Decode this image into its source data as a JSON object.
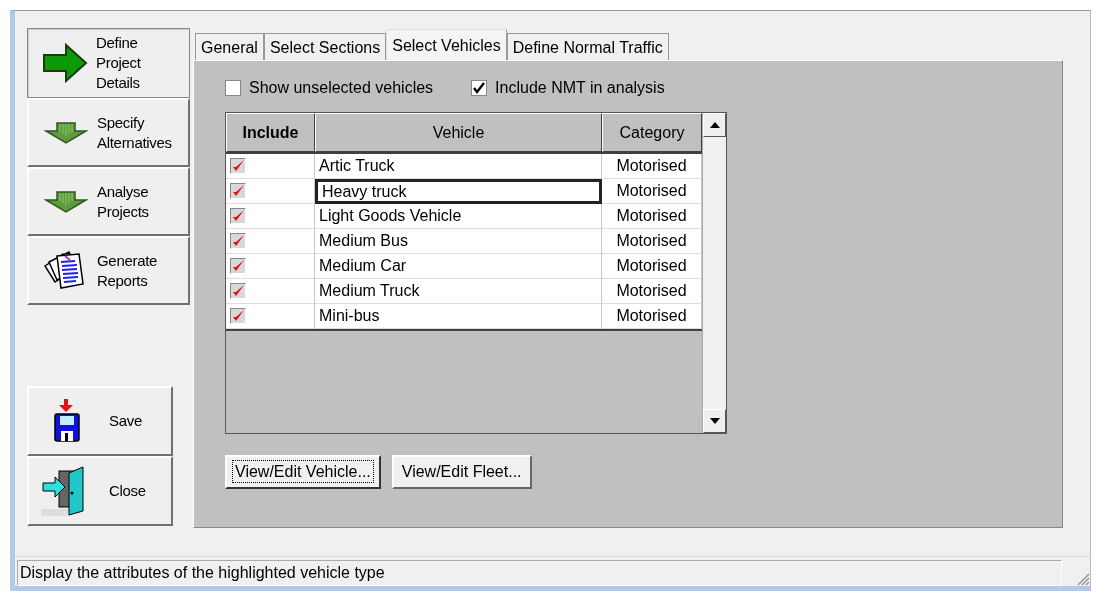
{
  "nav": [
    {
      "kind": "arrow-right",
      "label": "Define Project Details",
      "selected": true
    },
    {
      "kind": "arrow-down",
      "label": "Specify Alternatives",
      "selected": false
    },
    {
      "kind": "arrow-down",
      "label": "Analyse Projects",
      "selected": false
    },
    {
      "kind": "reports",
      "label": "Generate Reports",
      "selected": false
    }
  ],
  "actions": [
    {
      "kind": "save",
      "label": "Save"
    },
    {
      "kind": "close",
      "label": "Close"
    }
  ],
  "tabs": [
    {
      "label": "General",
      "selected": false
    },
    {
      "label": "Select Sections",
      "selected": false
    },
    {
      "label": "Select Vehicles",
      "selected": true
    },
    {
      "label": "Define Normal Traffic",
      "selected": false
    }
  ],
  "options": [
    {
      "label": "Show unselected vehicles",
      "checked": false
    },
    {
      "label": "Include NMT in analysis",
      "checked": true
    }
  ],
  "table": {
    "columns": [
      "Include",
      "Vehicle",
      "Category"
    ],
    "rows": [
      {
        "included": true,
        "vehicle": "Artic Truck",
        "category": "Motorised",
        "selected": false
      },
      {
        "included": true,
        "vehicle": "Heavy truck",
        "category": "Motorised",
        "selected": true
      },
      {
        "included": true,
        "vehicle": "Light Goods Vehicle",
        "category": "Motorised",
        "selected": false
      },
      {
        "included": true,
        "vehicle": "Medium Bus",
        "category": "Motorised",
        "selected": false
      },
      {
        "included": true,
        "vehicle": "Medium Car",
        "category": "Motorised",
        "selected": false
      },
      {
        "included": true,
        "vehicle": "Medium Truck",
        "category": "Motorised",
        "selected": false
      },
      {
        "included": true,
        "vehicle": "Mini-bus",
        "category": "Motorised",
        "selected": false
      }
    ]
  },
  "buttons": [
    {
      "label": "View/Edit Vehicle...",
      "focused": true
    },
    {
      "label": "View/Edit Fleet...",
      "focused": false
    }
  ],
  "status_bar": "Display the attributes of the highlighted vehicle type"
}
